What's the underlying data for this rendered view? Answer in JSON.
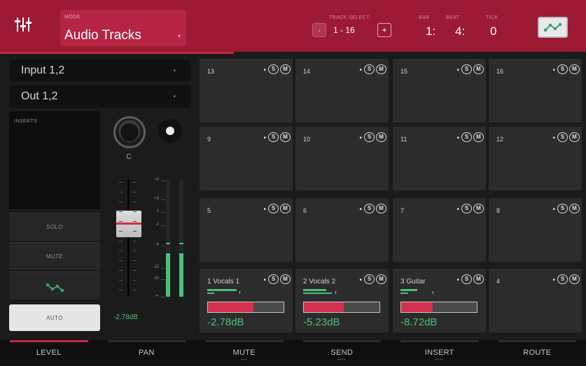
{
  "header": {
    "mode_caption": "MODE",
    "mode_value": "Audio Tracks",
    "track_caption": "TRACK SELECT",
    "track_minus": "-",
    "track_range": "1 - 16",
    "track_plus": "+",
    "bar_caption": "BAR",
    "bar_value": "1:",
    "beat_caption": "BEAT",
    "beat_value": "4:",
    "tick_caption": "TICK",
    "tick_value": "0",
    "automation_icon": "automation-curve-icon"
  },
  "left": {
    "input_value": "Input 1,2",
    "output_value": "Out 1,2",
    "inserts_caption": "INSERTS",
    "solo_label": "SOLO",
    "mute_label": "MUTE",
    "automation_icon": "automation-curve-icon",
    "auto_label": "AUTO",
    "pan_value": "C",
    "fader_value": "-2.78dB",
    "fader_level": 0.62,
    "meter_levels": [
      0.37,
      0.37
    ],
    "scale": [
      "+6",
      "+3",
      "0",
      "-3",
      "-9",
      "-20",
      "-30",
      "-∞"
    ]
  },
  "pads": [
    {
      "num": "13",
      "dot": "•",
      "s": "S",
      "m": "M"
    },
    {
      "num": "14",
      "dot": "•",
      "s": "S",
      "m": "M"
    },
    {
      "num": "15",
      "dot": "•",
      "s": "S",
      "m": "M"
    },
    {
      "num": "16",
      "dot": "•",
      "s": "S",
      "m": "M"
    },
    {
      "num": "9",
      "dot": "•",
      "s": "S",
      "m": "M"
    },
    {
      "num": "10",
      "dot": "•",
      "s": "S",
      "m": "M"
    },
    {
      "num": "11",
      "dot": "•",
      "s": "S",
      "m": "M"
    },
    {
      "num": "12",
      "dot": "•",
      "s": "S",
      "m": "M"
    },
    {
      "num": "5",
      "dot": "•",
      "s": "S",
      "m": "M"
    },
    {
      "num": "6",
      "dot": "•",
      "s": "S",
      "m": "M"
    },
    {
      "num": "7",
      "dot": "•",
      "s": "S",
      "m": "M"
    },
    {
      "num": "8",
      "dot": "•",
      "s": "S",
      "m": "M"
    },
    {
      "name": "1 Vocals 1",
      "dot": "•",
      "s": "S",
      "m": "M",
      "db": "-2.78dB",
      "level": 0.6,
      "meter": [
        0.38,
        0.09
      ]
    },
    {
      "name": "2 Vocals 2",
      "dot": "•",
      "s": "S",
      "m": "M",
      "db": "-5.23dB",
      "level": 0.53,
      "meter": [
        0.3,
        0.37
      ]
    },
    {
      "name": "3 Guitar",
      "dot": "•",
      "s": "S",
      "m": "M",
      "db": "-8.72dB",
      "level": 0.42,
      "meter": [
        0.22,
        0.1
      ]
    },
    {
      "num": "4",
      "dot": "•",
      "s": "S",
      "m": "M"
    }
  ],
  "tabs": [
    {
      "label": "LEVEL",
      "dots": "",
      "active": true
    },
    {
      "label": "PAN",
      "dots": "",
      "active": false
    },
    {
      "label": "MUTE",
      "dots": "•••",
      "active": false
    },
    {
      "label": "SEND",
      "dots": "••••",
      "active": false
    },
    {
      "label": "INSERT",
      "dots": "••••",
      "active": false
    },
    {
      "label": "ROUTE",
      "dots": "",
      "active": false
    }
  ],
  "colors": {
    "header": "#9c1a34",
    "accent": "#c52645",
    "meter_green": "#4dbd7c",
    "level_red": "#d2304c"
  }
}
